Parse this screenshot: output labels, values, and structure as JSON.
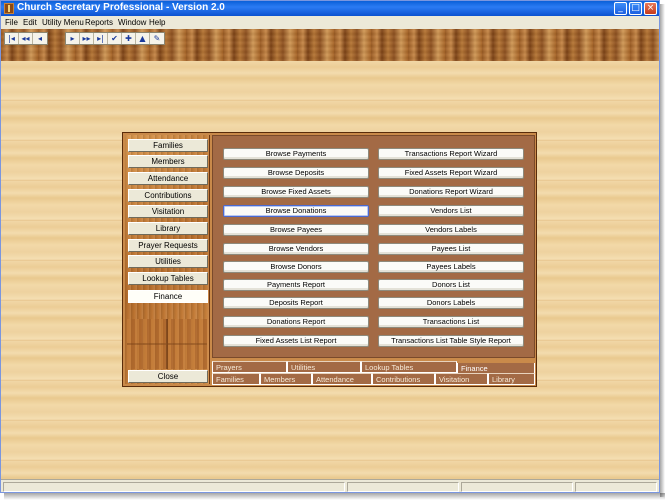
{
  "window": {
    "title": "Church Secretary Professional - Version 2.0"
  },
  "title_buttons": {
    "minimize": "_",
    "maximize": "□",
    "close": "×"
  },
  "menu": [
    "File",
    "Edit",
    "Utility Menu",
    "Reports",
    "Window",
    "Help"
  ],
  "toolbar": {
    "group1": [
      "|◂",
      "◂◂",
      "◂"
    ],
    "group2": [
      "▸",
      "▸▸",
      "▸|",
      "✔",
      "✚",
      "▲",
      "✎"
    ]
  },
  "nav": {
    "items": [
      "Families",
      "Members",
      "Attendance",
      "Contributions",
      "Visitation",
      "Library",
      "Prayer Requests",
      "Utilities",
      "Lookup Tables",
      "Finance"
    ],
    "active": "Finance",
    "close_label": "Close"
  },
  "finance": {
    "left_column": [
      "Browse Payments",
      "Browse Deposits",
      "Browse Fixed Assets",
      "Browse Donations",
      "Browse Payees",
      "Browse Vendors",
      "Browse Donors",
      "Payments Report",
      "Deposits Report",
      "Donations Report",
      "Fixed Assets List Report"
    ],
    "right_column": [
      "Transactions Report Wizard",
      "Fixed Assets Report Wizard",
      "Donations Report Wizard",
      "Vendors List",
      "Vendors Labels",
      "Payees List",
      "Payees Labels",
      "Donors List",
      "Donors Labels",
      "Transactions List",
      "Transactions List Table Style Report"
    ],
    "focused": "Browse Donations"
  },
  "tabs": {
    "upper_row": [
      "Prayers",
      "Utilities",
      "Lookup Tables",
      "Finance"
    ],
    "lower_row": [
      "Families",
      "Members",
      "Attendance",
      "Contributions",
      "Visitation",
      "Library"
    ],
    "active": "Finance"
  },
  "colors": {
    "title_bar": "#0a5fd8",
    "panel_brown": "#a36a45",
    "wood_light": "#f1d7a6"
  }
}
